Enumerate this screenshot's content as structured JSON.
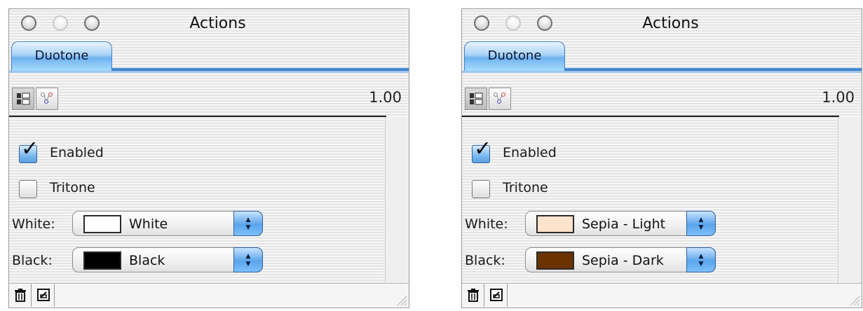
{
  "panels": [
    {
      "title": "Actions",
      "tab": "Duotone",
      "version": "1.00",
      "enabled_label": "Enabled",
      "enabled": true,
      "tritone_label": "Tritone",
      "tritone": false,
      "white_label": "White:",
      "white_value": "White",
      "white_color": "#ffffff",
      "black_label": "Black:",
      "black_value": "Black",
      "black_color": "#000000"
    },
    {
      "title": "Actions",
      "tab": "Duotone",
      "version": "1.00",
      "enabled_label": "Enabled",
      "enabled": true,
      "tritone_label": "Tritone",
      "tritone": false,
      "white_label": "White:",
      "white_value": "Sepia - Light",
      "white_color": "#fde3cc",
      "black_label": "Black:",
      "black_value": "Sepia - Dark",
      "black_color": "#6b3300"
    }
  ],
  "icons": {
    "close": "close-button",
    "minimize": "minimize-button",
    "zoom": "zoom-button",
    "list_view": "list-view-icon",
    "graph_view": "graph-view-icon",
    "trash": "trash-icon",
    "duplicate": "duplicate-icon",
    "resize": "resize-grip-icon"
  }
}
